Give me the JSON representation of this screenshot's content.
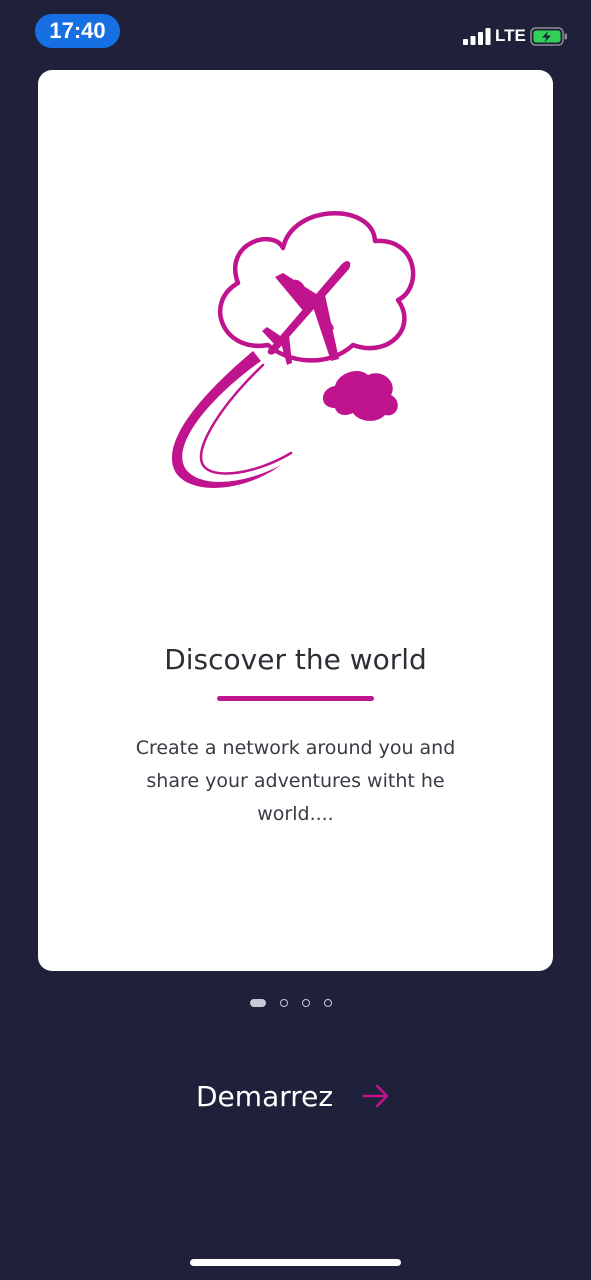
{
  "status_bar": {
    "time": "17:40",
    "network": "LTE"
  },
  "card": {
    "title": "Discover the world",
    "description": "Create a network around you and share your adventures witht he world...."
  },
  "pager": {
    "total": 4,
    "active_index": 0
  },
  "start_button": {
    "label": "Demarrez",
    "icon": "arrow-right-icon"
  },
  "colors": {
    "background": "#1f2039",
    "accent": "#c0148e",
    "time_pill": "#1670e4",
    "battery": "#30d158"
  }
}
